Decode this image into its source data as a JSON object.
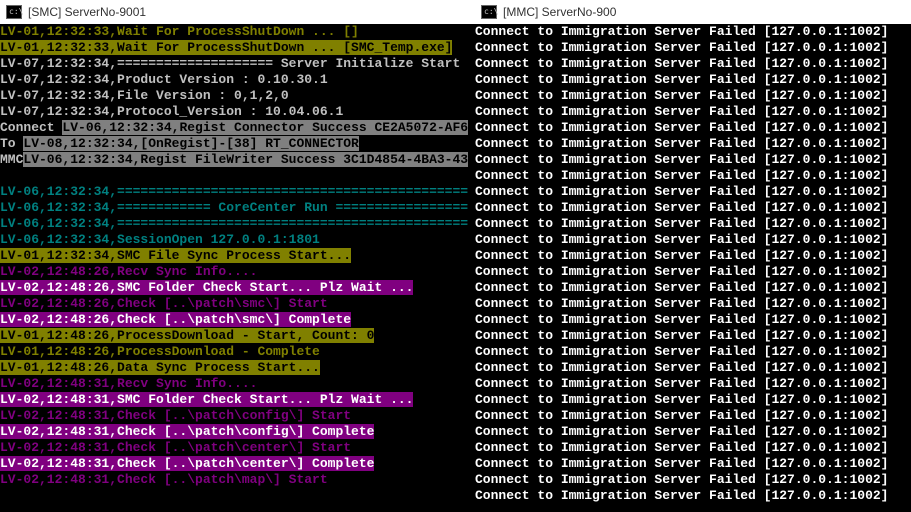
{
  "left": {
    "title": "[SMC]  ServerNo-9001",
    "lines": [
      [
        {
          "c": "fg-olive-black",
          "t": "LV-01,12:32:33,Wait For ProcessShutDown ... []"
        }
      ],
      [
        {
          "c": "fg-black-olive",
          "t": "LV-01,12:32:33,Wait For ProcessShutDown ... [SMC_Temp.exe]"
        }
      ],
      [
        {
          "c": "fg-gray-black",
          "t": "LV-07,12:32:34,==================== Server Initialize Start"
        }
      ],
      [
        {
          "c": "fg-gray-black",
          "t": "LV-07,12:32:34,Product Version : 0.10.30.1"
        }
      ],
      [
        {
          "c": "fg-gray-black",
          "t": "LV-07,12:32:34,File Version : 0,1,2,0"
        }
      ],
      [
        {
          "c": "fg-gray-black",
          "t": "LV-07,12:32:34,Protocol_Version : 10.04.06.1"
        }
      ],
      [
        {
          "c": "fg-gray-black",
          "t": "Connect "
        },
        {
          "c": "fg-black-gray",
          "t": "LV-06,12:32:34,Regist Connector Success CE2A5072-AF6"
        }
      ],
      [
        {
          "c": "fg-gray-black",
          "t": "To "
        },
        {
          "c": "fg-black-gray",
          "t": "LV-08,12:32:34,[OnRegist]-[38]  RT_CONNECTOR"
        }
      ],
      [
        {
          "c": "fg-gray-black",
          "t": "MMC"
        },
        {
          "c": "fg-black-gray",
          "t": "LV-06,12:32:34,Regist FileWriter Success 3C1D4854-4BA3-43"
        }
      ],
      [],
      [
        {
          "c": "fg-teal-black",
          "t": "LV-06,12:32:34,============================================="
        }
      ],
      [
        {
          "c": "fg-teal-black",
          "t": "LV-06,12:32:34,============ CoreCenter Run ================="
        }
      ],
      [
        {
          "c": "fg-teal-black",
          "t": "LV-06,12:32:34,============================================="
        }
      ],
      [
        {
          "c": "fg-teal-black",
          "t": "LV-06,12:32:34,SessionOpen 127.0.0.1:1801"
        }
      ],
      [
        {
          "c": "fg-black-olive",
          "t": "LV-01,12:32:34,SMC File Sync Process Start..."
        }
      ],
      [
        {
          "c": "fg-purple-black",
          "t": "LV-02,12:48:26,Recv Sync Info...."
        }
      ],
      [
        {
          "c": "fg-white-purple",
          "t": "LV-02,12:48:26,SMC Folder Check Start... Plz Wait ..."
        }
      ],
      [
        {
          "c": "fg-purple-black",
          "t": "LV-02,12:48:26,Check [..\\patch\\smc\\] Start"
        }
      ],
      [
        {
          "c": "fg-white-purple",
          "t": "LV-02,12:48:26,Check [..\\patch\\smc\\] Complete"
        }
      ],
      [
        {
          "c": "fg-black-olive",
          "t": "LV-01,12:48:26,ProcessDownload - Start, Count: 0"
        }
      ],
      [
        {
          "c": "fg-olive-black",
          "t": "LV-01,12:48:26,ProcessDownload - Complete"
        }
      ],
      [
        {
          "c": "fg-black-olive",
          "t": "LV-01,12:48:26,Data Sync Process Start..."
        }
      ],
      [
        {
          "c": "fg-purple-black",
          "t": "LV-02,12:48:31,Recv Sync Info...."
        }
      ],
      [
        {
          "c": "fg-white-purple",
          "t": "LV-02,12:48:31,SMC Folder Check Start... Plz Wait ..."
        }
      ],
      [
        {
          "c": "fg-purple-black",
          "t": "LV-02,12:48:31,Check [..\\patch\\config\\] Start"
        }
      ],
      [
        {
          "c": "fg-white-purple",
          "t": "LV-02,12:48:31,Check [..\\patch\\config\\] Complete"
        }
      ],
      [
        {
          "c": "fg-purple-black",
          "t": "LV-02,12:48:31,Check [..\\patch\\center\\] Start"
        }
      ],
      [
        {
          "c": "fg-white-purple",
          "t": "LV-02,12:48:31,Check [..\\patch\\center\\] Complete"
        }
      ],
      [
        {
          "c": "fg-purple-black",
          "t": "LV-02,12:48:31,Check [..\\patch\\map\\] Start"
        }
      ]
    ]
  },
  "right": {
    "title": "[MMC]  ServerNo-900",
    "line_text": "Connect to Immigration Server Failed [127.0.0.1:1002]",
    "line_count": 30
  }
}
